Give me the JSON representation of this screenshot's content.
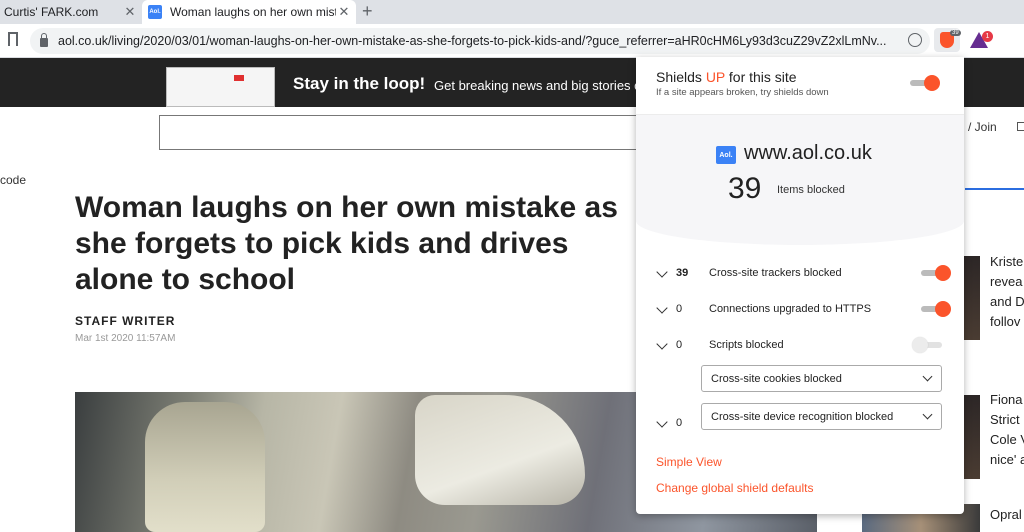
{
  "tabs": [
    {
      "title": "Curtis' FARK.com",
      "close": "✕"
    },
    {
      "title": "Woman laughs on her own mistake",
      "favicon": "Aol.",
      "close": "✕"
    }
  ],
  "new_tab": "+",
  "address_bar": {
    "url": "aol.co.uk/living/2020/03/01/woman-laughs-on-her-own-mistake-as-she-forgets-to-pick-kids-and/?guce_referrer=aHR0cHM6Ly93d3cuZ29vZ2xlLmNv..."
  },
  "toolbar": {
    "brave_badge": "39",
    "rewards_badge": "1"
  },
  "banner": {
    "title": "Stay in the loop!",
    "subtitle": "Get breaking news and big stories on"
  },
  "header": {
    "signin": "n / Join",
    "code_text": "code"
  },
  "article": {
    "headline": "Woman laughs on her own mistake as she forgets to pick kids and drives alone to school",
    "author": "STAFF WRITER",
    "date": "Mar 1st 2020 11:57AM"
  },
  "sidebar": {
    "story1": [
      "Kriste",
      "revea",
      "and D",
      "follov"
    ],
    "story2": [
      "Fiona",
      "Strict",
      "Cole V",
      "nice' a"
    ],
    "story3": [
      "Opral"
    ]
  },
  "shields": {
    "title_prefix": "Shields ",
    "title_status": "UP",
    "title_suffix": " for this site",
    "subtitle": "If a site appears broken, try shields down",
    "enabled": true,
    "site_favicon": "Aol.",
    "site": "www.aol.co.uk",
    "items_blocked": "39",
    "items_blocked_label": "Items blocked",
    "rows": [
      {
        "count": "39",
        "label": "Cross-site trackers blocked",
        "toggle": true
      },
      {
        "count": "0",
        "label": "Connections upgraded to HTTPS",
        "toggle": true
      },
      {
        "count": "0",
        "label": "Scripts blocked",
        "toggle": false
      }
    ],
    "cookies_select": "Cross-site cookies blocked",
    "fingerprint_count": "0",
    "fingerprint_select": "Cross-site device recognition blocked",
    "simple_view": "Simple View",
    "global_defaults": "Change global shield defaults"
  },
  "colors": {
    "brave_orange": "#fb542b",
    "aol_blue": "#3b82f6",
    "banner_bg": "#232323"
  }
}
